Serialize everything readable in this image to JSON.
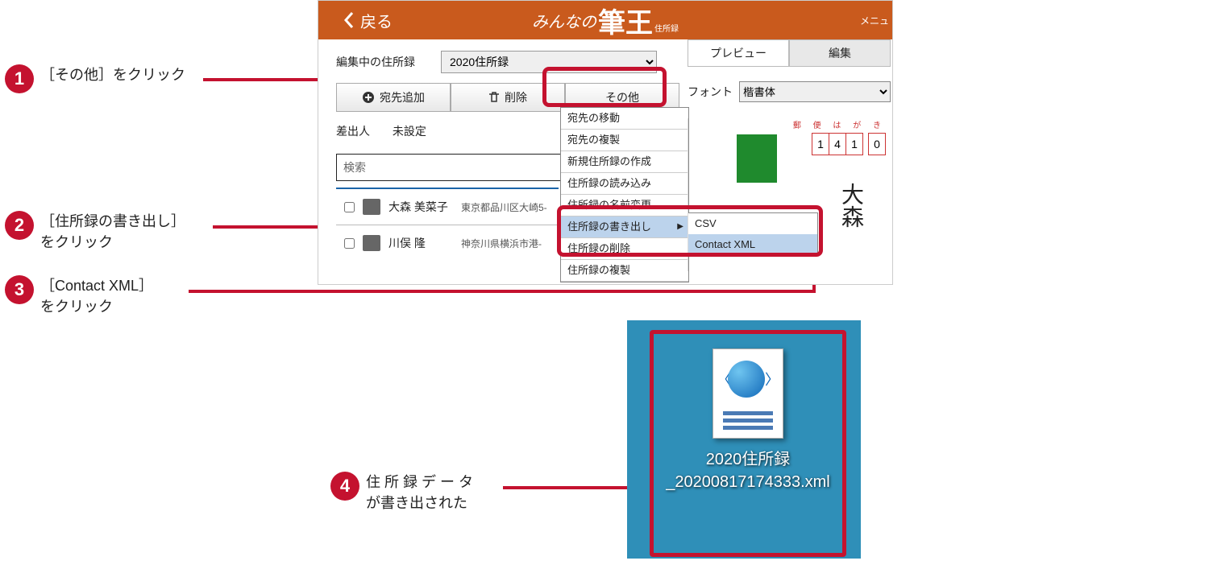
{
  "callouts": {
    "c1": {
      "num": "1",
      "text": "［その他］をクリック"
    },
    "c2": {
      "num": "2",
      "line1": "［住所録の書き出し］",
      "line2": "をクリック"
    },
    "c3": {
      "num": "3",
      "line1": "［Contact XML］",
      "line2": "をクリック"
    },
    "c4": {
      "num": "4",
      "line1": "住 所 録 デ ー タ",
      "line2": "が書き出された"
    }
  },
  "app": {
    "back": "戻る",
    "brand_left": "みんなの",
    "brand_main": "筆王",
    "brand_small": "住所録",
    "menu": "メニュ",
    "editing_label": "編集中の住所録",
    "addressbook": "2020住所録",
    "btn_add": "宛先追加",
    "btn_delete": "削除",
    "btn_other": "その他",
    "sender_label": "差出人",
    "sender_value": "未設定",
    "search_placeholder": "検索",
    "list": [
      {
        "name": "大森 美菜子",
        "addr": "東京都品川区大崎5-"
      },
      {
        "name": "川俣 隆",
        "addr": "神奈川県横浜市港-"
      }
    ],
    "menu_items": [
      "宛先の移動",
      "宛先の複製",
      "新規住所録の作成",
      "住所録の読み込み",
      "住所録の名前変更",
      "住所録の書き出し",
      "住所録の削除",
      "住所録の複製"
    ],
    "menu_selected_index": 5,
    "submenu": [
      "CSV",
      "Contact XML"
    ],
    "submenu_selected_index": 1,
    "right": {
      "tab_preview": "プレビュー",
      "tab_edit": "編集",
      "font_label": "フォント",
      "font_value": "楷書体",
      "postcard_label": "郵 便 は が き",
      "zip": [
        "1",
        "4",
        "1",
        "gap",
        "0"
      ],
      "vname": "大森"
    }
  },
  "desk": {
    "filename": "2020住所録_20200817174333.xml"
  }
}
